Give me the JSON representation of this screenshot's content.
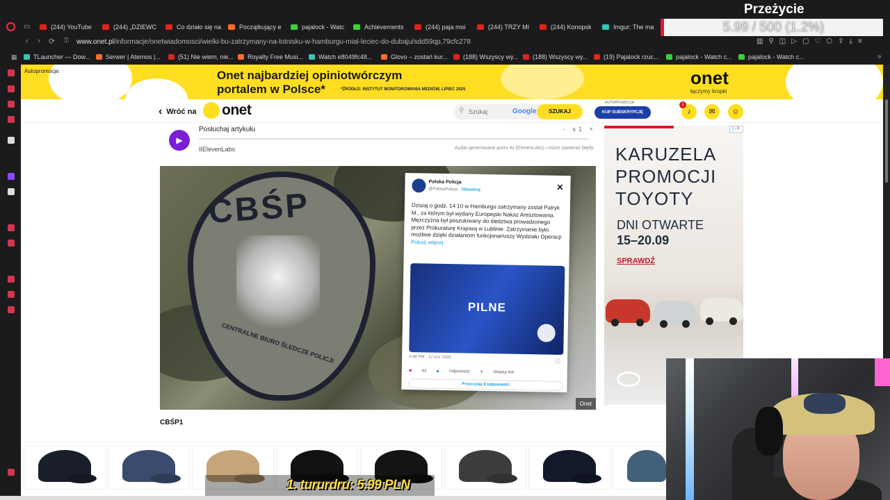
{
  "browser": {
    "tabs": [
      {
        "label": "(244) YouTube",
        "fav": "yt"
      },
      {
        "label": "(244) „DZIEWC",
        "fav": "yt"
      },
      {
        "label": "Co działo się na",
        "fav": "yt"
      },
      {
        "label": "Początkujący e",
        "fav": "orange"
      },
      {
        "label": "pajalock - Watc",
        "fav": "green"
      },
      {
        "label": "Achievements",
        "fav": "green"
      },
      {
        "label": "(244) paja moi",
        "fav": "yt"
      },
      {
        "label": "(244) TRZY MI",
        "fav": "yt"
      },
      {
        "label": "(244) Konopsk",
        "fav": "yt"
      },
      {
        "label": "Imgur: The ma",
        "fav": "teal"
      }
    ],
    "url_domain": "www.onet.pl",
    "url_path": "/informacje/onetwiadomosci/wielki-bu-zatrzymany-na-lotnisku-w-hamburgu-mial-leciec-do-dubaju/sdd59qp,79cfc278",
    "bookmarks": [
      {
        "label": "TLauncher — Dow...",
        "fav": "teal"
      },
      {
        "label": "Serwer | Aternos |...",
        "fav": "orange"
      },
      {
        "label": "(51) Nie wiem, nie...",
        "fav": "yt"
      },
      {
        "label": "Royalty Free Musi...",
        "fav": "orange"
      },
      {
        "label": "Watch e8049fc48...",
        "fav": "teal"
      },
      {
        "label": "Glovo – zostań kur...",
        "fav": "orange"
      },
      {
        "label": "(188) Wszyscy wy...",
        "fav": "yt"
      },
      {
        "label": "(188) Wszyscy wy...",
        "fav": "yt"
      },
      {
        "label": "(19) Pajalock rzuc...",
        "fav": "yt"
      },
      {
        "label": "pajalock - Watch c...",
        "fav": "green"
      },
      {
        "label": "pajalock - Watch c...",
        "fav": "green"
      }
    ]
  },
  "overlay": {
    "title": "Przeżycie",
    "progress_text": "5.99 / 500 (1.2%)",
    "progress_fraction": 0.012
  },
  "promo": {
    "label": "Autopromocja",
    "headline_line1": "Onet najbardziej opiniotwórczym",
    "headline_line2": "portalem w Polsce*",
    "source": "*ŹRÓDŁO: INSTYTUT MONITOROWANIA MEDIÓW, LIPIEC 2025",
    "logo": "onet",
    "tagline": "łączymy kropki"
  },
  "header": {
    "back_label": "Wróć na",
    "logo": "onet",
    "search_placeholder": "Szukaj",
    "search_engine": "Google",
    "search_button": "SZUKAJ",
    "autopromo_small": "AUTOPROMOCJA",
    "subscribe": "KUP SUBSKRYPCJĘ",
    "notif_count": "1"
  },
  "audio": {
    "title": "Posłuchaj artykułu",
    "speed": "x1",
    "provider": "IIElevenLabs",
    "note": "Audio generowane przez AI (ElevenLabs) i może zawierać błędy"
  },
  "article_image": {
    "patch_text": "CBŚP",
    "patch_ring": "CENTRALNE BIURO ŚLEDCZE POLICJI",
    "credit": "Onet",
    "tweet": {
      "name": "Polska Policja",
      "handle": "@PolskaPolicja",
      "follow": "Obserwuj",
      "body": "Dzisiaj o godz. 14:10 w Hamburgu zatrzymany został Patryk M., za którym był wydany Europejski Nakaz Aresztowania. Mężczyzna był poszukiwany do śledztwa prowadzonego przez Prokuraturę Krajową w Lublinie. Zatrzymanie było możliwe dzięki działaniom funkcjonariuszy Wydziału Operacji",
      "more": "Pokaż więcej",
      "image_text": "PILNE",
      "time": "4:38 PM · 12 wrz 2025",
      "likes": "43",
      "reply": "Odpowiedz",
      "copy": "Skopiuj link",
      "replies": "Przeczytaj 8 odpowiedzi"
    }
  },
  "caption": "CBŚP1",
  "ad": {
    "headline": "KARUZELA PROMOCJI TOYOTY",
    "line1": "DNI OTWARTE",
    "line2": "15–20.09",
    "cta": "SPRAWDŹ"
  },
  "donation": {
    "text": "1. tururdru:",
    "amount": "5.99 PLN"
  }
}
